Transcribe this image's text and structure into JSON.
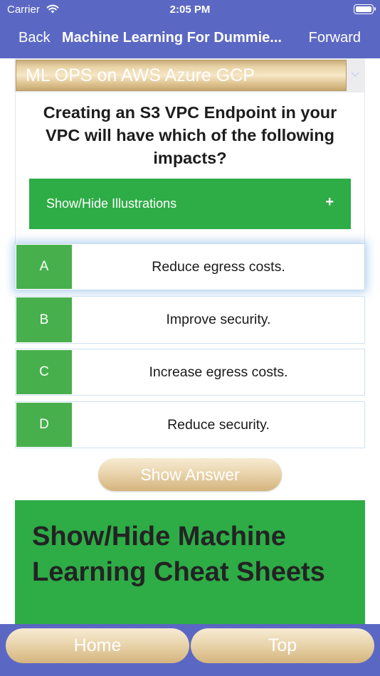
{
  "status_bar": {
    "carrier": "Carrier",
    "time": "2:05 PM"
  },
  "nav": {
    "back_label": "Back",
    "title": "Machine Learning For Dummie...",
    "forward_label": "Forward"
  },
  "category_picker": {
    "selected": "ML OPS on AWS Azure GCP"
  },
  "question": {
    "text": "Creating an S3 VPC Endpoint in your VPC will have which of the following impacts?"
  },
  "illustrations": {
    "label": "Show/Hide Illustrations",
    "toggle_symbol": "+"
  },
  "options": [
    {
      "letter": "A",
      "text": "Reduce egress costs.",
      "selected": true
    },
    {
      "letter": "B",
      "text": "Improve security.",
      "selected": false
    },
    {
      "letter": "C",
      "text": "Increase egress costs.",
      "selected": false
    },
    {
      "letter": "D",
      "text": "Reduce security.",
      "selected": false
    }
  ],
  "show_answer_label": "Show Answer",
  "cheat_sheets_label": "Show/Hide Machine Learning Cheat Sheets",
  "bottom_bar": {
    "home_label": "Home",
    "top_label": "Top"
  },
  "colors": {
    "nav": "#5b68c3",
    "green": "#2eac46",
    "option_green": "#47b04c",
    "gold": "#dcc08b"
  },
  "icons": {
    "wifi": "wifi-icon",
    "battery": "battery-icon",
    "chevron": "chevron-down-icon",
    "plus": "plus-icon"
  }
}
